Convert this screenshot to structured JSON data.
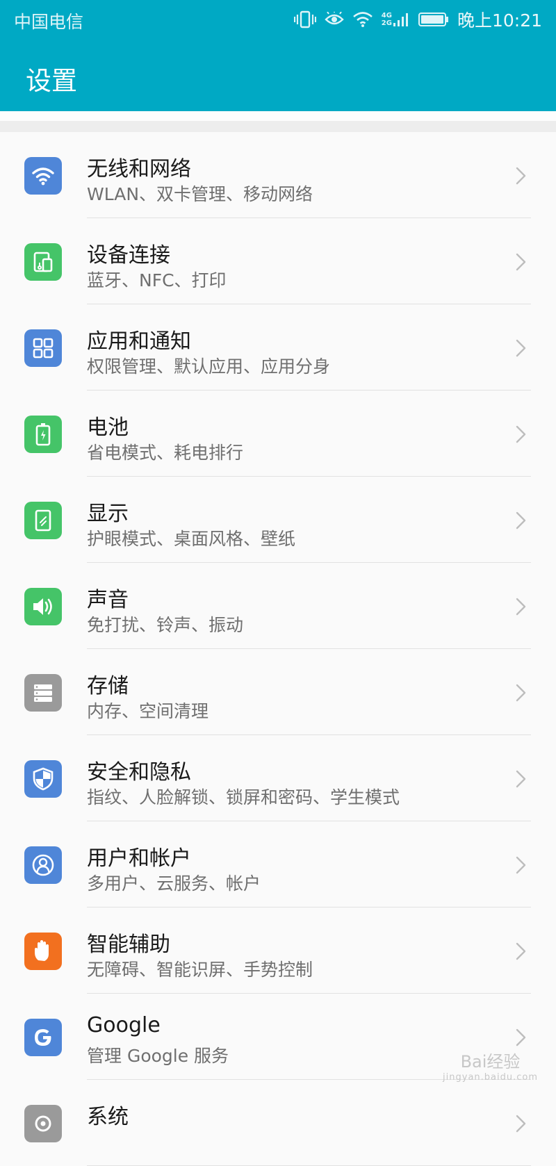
{
  "status_bar": {
    "carrier": "中国电信",
    "network_label_top": "4G",
    "network_label_bottom": "2G",
    "time": "晚上10:21"
  },
  "header": {
    "title": "设置"
  },
  "colors": {
    "header_bg": "#00a9c4",
    "blue_icon": "#4f86d8",
    "green_icon": "#45c468",
    "gray_icon": "#9a9a9a",
    "orange_icon": "#f2701f"
  },
  "settings": [
    {
      "title": "无线和网络",
      "subtitle": "WLAN、双卡管理、移动网络",
      "icon": "wifi-icon",
      "color": "#4f86d8"
    },
    {
      "title": "设备连接",
      "subtitle": "蓝牙、NFC、打印",
      "icon": "device-connection-icon",
      "color": "#45c468"
    },
    {
      "title": "应用和通知",
      "subtitle": "权限管理、默认应用、应用分身",
      "icon": "apps-grid-icon",
      "color": "#4f86d8"
    },
    {
      "title": "电池",
      "subtitle": "省电模式、耗电排行",
      "icon": "battery-icon",
      "color": "#45c468"
    },
    {
      "title": "显示",
      "subtitle": "护眼模式、桌面风格、壁纸",
      "icon": "display-icon",
      "color": "#45c468"
    },
    {
      "title": "声音",
      "subtitle": "免打扰、铃声、振动",
      "icon": "speaker-icon",
      "color": "#45c468"
    },
    {
      "title": "存储",
      "subtitle": "内存、空间清理",
      "icon": "storage-icon",
      "color": "#9a9a9a"
    },
    {
      "title": "安全和隐私",
      "subtitle": "指纹、人脸解锁、锁屏和密码、学生模式",
      "icon": "shield-icon",
      "color": "#4f86d8"
    },
    {
      "title": "用户和帐户",
      "subtitle": "多用户、云服务、帐户",
      "icon": "user-icon",
      "color": "#4f86d8"
    },
    {
      "title": "智能辅助",
      "subtitle": "无障碍、智能识屏、手势控制",
      "icon": "hand-icon",
      "color": "#f2701f"
    },
    {
      "title": "Google",
      "subtitle": "管理 Google 服务",
      "icon": "google-icon",
      "color": "#4f86d8"
    },
    {
      "title": "系统",
      "subtitle": "",
      "icon": "system-icon",
      "color": "#9a9a9a"
    }
  ],
  "watermark": {
    "line1": "Bai经验",
    "line2": "jingyan.baidu.com"
  }
}
